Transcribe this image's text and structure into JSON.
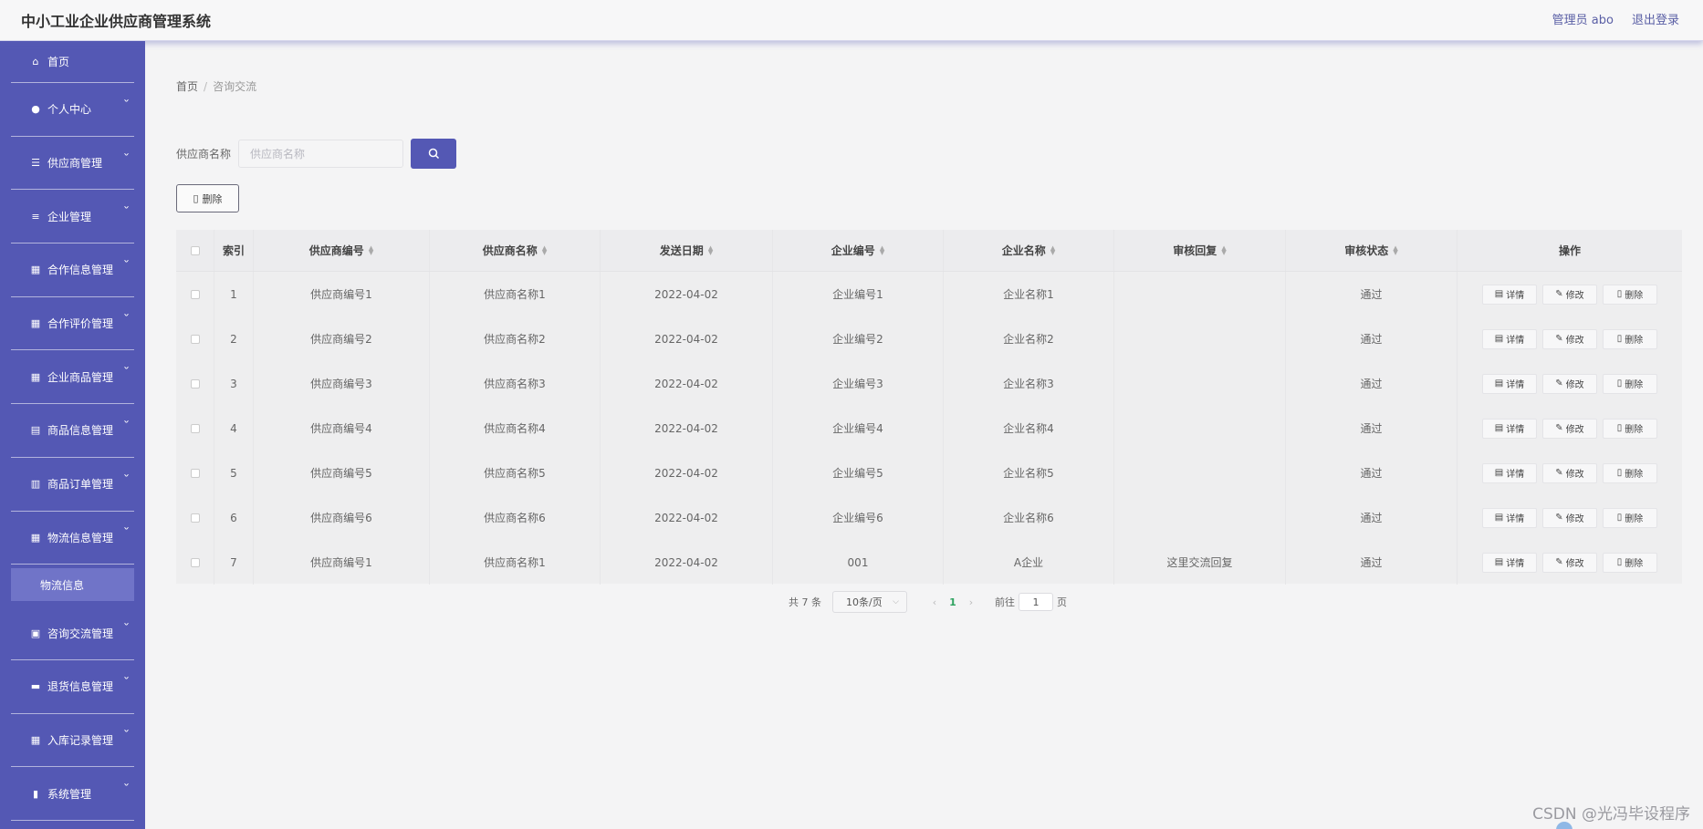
{
  "header": {
    "app_title": "中小工业企业供应商管理系统",
    "user_label": "管理员 abo",
    "logout_label": "退出登录"
  },
  "sidebar": {
    "items": [
      {
        "label": "首页",
        "icon": "home-icon",
        "glyph": "⌂",
        "has_children": false
      },
      {
        "label": "个人中心",
        "icon": "user-icon",
        "glyph": "●",
        "has_children": true
      },
      {
        "label": "供应商管理",
        "icon": "list-icon",
        "glyph": "☰",
        "has_children": true
      },
      {
        "label": "企业管理",
        "icon": "sliders-icon",
        "glyph": "≡",
        "has_children": true
      },
      {
        "label": "合作信息管理",
        "icon": "grid-icon",
        "glyph": "▦",
        "has_children": true
      },
      {
        "label": "合作评价管理",
        "icon": "grid-icon",
        "glyph": "▦",
        "has_children": true
      },
      {
        "label": "企业商品管理",
        "icon": "grid-icon",
        "glyph": "▦",
        "has_children": true
      },
      {
        "label": "商品信息管理",
        "icon": "document-icon",
        "glyph": "▤",
        "has_children": true
      },
      {
        "label": "商品订单管理",
        "icon": "building-icon",
        "glyph": "▥",
        "has_children": true
      },
      {
        "label": "物流信息管理",
        "icon": "grid-icon",
        "glyph": "▦",
        "has_children": true
      },
      {
        "label": "咨询交流管理",
        "icon": "clipboard-icon",
        "glyph": "▣",
        "has_children": true
      },
      {
        "label": "退货信息管理",
        "icon": "ticket-icon",
        "glyph": "▬",
        "has_children": true
      },
      {
        "label": "入库记录管理",
        "icon": "grid-icon",
        "glyph": "▦",
        "has_children": true
      },
      {
        "label": "系统管理",
        "icon": "bar-chart-icon",
        "glyph": "▮",
        "has_children": true
      }
    ],
    "submenu_label": "物流信息"
  },
  "breadcrumb": {
    "home": "首页",
    "sep": "/",
    "current": "咨询交流"
  },
  "search": {
    "label": "供应商名称",
    "placeholder": "供应商名称",
    "value": ""
  },
  "toolbar": {
    "delete_label": "删除"
  },
  "table": {
    "columns": [
      "索引",
      "供应商编号",
      "供应商名称",
      "发送日期",
      "企业编号",
      "企业名称",
      "审核回复",
      "审核状态",
      "操作"
    ],
    "sortable": [
      false,
      true,
      true,
      true,
      true,
      true,
      true,
      true,
      false
    ],
    "rows": [
      {
        "index": "1",
        "supplier_no": "供应商编号1",
        "supplier_name": "供应商名称1",
        "date": "2022-04-02",
        "company_no": "企业编号1",
        "company_name": "企业名称1",
        "reply": "",
        "status": "通过"
      },
      {
        "index": "2",
        "supplier_no": "供应商编号2",
        "supplier_name": "供应商名称2",
        "date": "2022-04-02",
        "company_no": "企业编号2",
        "company_name": "企业名称2",
        "reply": "",
        "status": "通过"
      },
      {
        "index": "3",
        "supplier_no": "供应商编号3",
        "supplier_name": "供应商名称3",
        "date": "2022-04-02",
        "company_no": "企业编号3",
        "company_name": "企业名称3",
        "reply": "",
        "status": "通过"
      },
      {
        "index": "4",
        "supplier_no": "供应商编号4",
        "supplier_name": "供应商名称4",
        "date": "2022-04-02",
        "company_no": "企业编号4",
        "company_name": "企业名称4",
        "reply": "",
        "status": "通过"
      },
      {
        "index": "5",
        "supplier_no": "供应商编号5",
        "supplier_name": "供应商名称5",
        "date": "2022-04-02",
        "company_no": "企业编号5",
        "company_name": "企业名称5",
        "reply": "",
        "status": "通过"
      },
      {
        "index": "6",
        "supplier_no": "供应商编号6",
        "supplier_name": "供应商名称6",
        "date": "2022-04-02",
        "company_no": "企业编号6",
        "company_name": "企业名称6",
        "reply": "",
        "status": "通过"
      },
      {
        "index": "7",
        "supplier_no": "供应商编号1",
        "supplier_name": "供应商名称1",
        "date": "2022-04-02",
        "company_no": "001",
        "company_name": "A企业",
        "reply": "这里交流回复",
        "status": "通过"
      }
    ],
    "row_actions": {
      "detail": "详情",
      "edit": "修改",
      "delete": "删除"
    }
  },
  "pagination": {
    "total_text": "共 7 条",
    "page_size": "10条/页",
    "current_page": "1",
    "goto_label": "前往",
    "goto_value": "1",
    "page_suffix": "页"
  },
  "watermark": "CSDN @光冯毕设程序",
  "colors": {
    "sidebar_bg": "#5458b4",
    "accent": "#5458b4",
    "active_page": "#2fa360"
  }
}
